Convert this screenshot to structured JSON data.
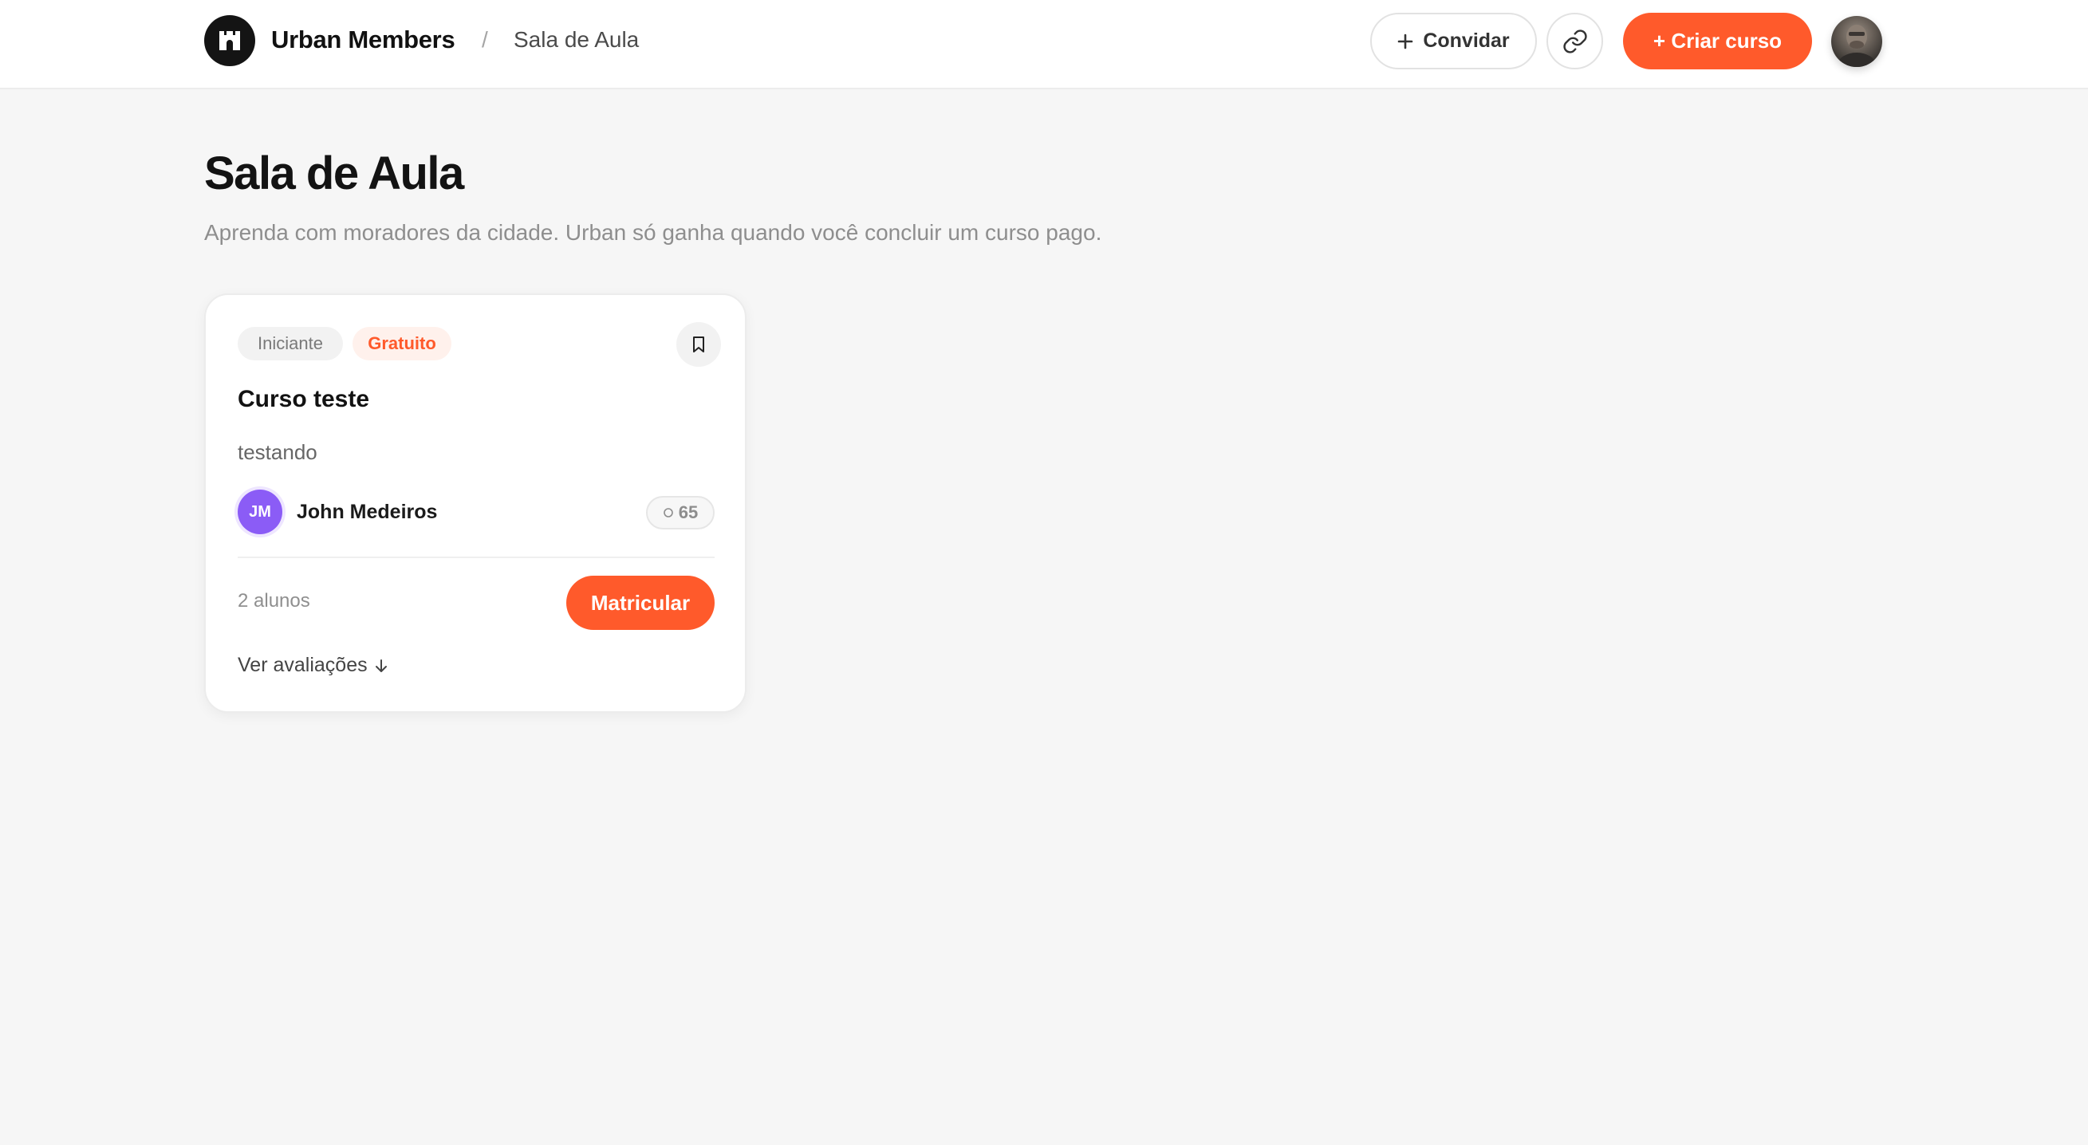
{
  "header": {
    "brand_name": "Urban Members",
    "breadcrumb_separator": "/",
    "breadcrumb_current": "Sala de Aula",
    "invite_label": "Convidar",
    "create_course_label": "+ Criar curso"
  },
  "page": {
    "title": "Sala de Aula",
    "subtitle": "Aprenda com moradores da cidade. Urban só ganha quando você concluir um curso pago."
  },
  "courses": [
    {
      "level_tag": "Iniciante",
      "price_tag": "Gratuito",
      "title": "Curso teste",
      "description": "testando",
      "author_initials": "JM",
      "author_name": "John Medeiros",
      "points": "65",
      "students": "2 alunos",
      "enroll_label": "Matricular",
      "reviews_label": "Ver avaliações"
    }
  ],
  "colors": {
    "accent": "#ff5a2b",
    "author_avatar": "#8b5cf6",
    "background": "#f6f6f6"
  },
  "icons": {
    "brand": "castle-icon",
    "invite": "plus-icon",
    "copy_link": "link-icon",
    "bookmark": "bookmark-icon",
    "points": "coin-icon",
    "reviews": "arrow-down-icon"
  }
}
